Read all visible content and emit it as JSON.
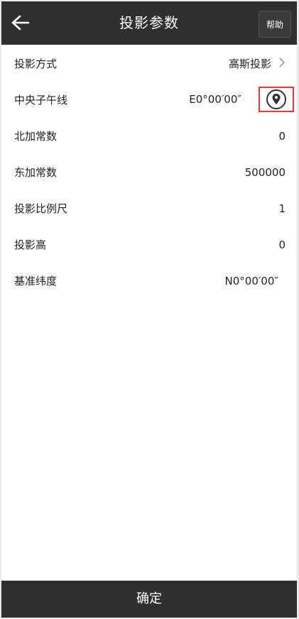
{
  "header": {
    "title": "投影参数",
    "back_icon": "arrow-left-icon",
    "help_label": "帮助"
  },
  "params": [
    {
      "label": "投影方式",
      "value": "高斯投影"
    },
    {
      "label": "中央子午线",
      "value": "E0°00′00″"
    },
    {
      "label": "北加常数",
      "value": "0"
    },
    {
      "label": "东加常数",
      "value": "500000"
    },
    {
      "label": "投影比例尺",
      "value": "1"
    },
    {
      "label": "投影高",
      "value": "0"
    },
    {
      "label": "基准纬度",
      "value": "N0°00′00″"
    }
  ],
  "footer": {
    "confirm_label": "确定"
  },
  "colors": {
    "bar": "#2f2f2f",
    "highlight": "#e23a3a",
    "background": "#ffffff"
  }
}
